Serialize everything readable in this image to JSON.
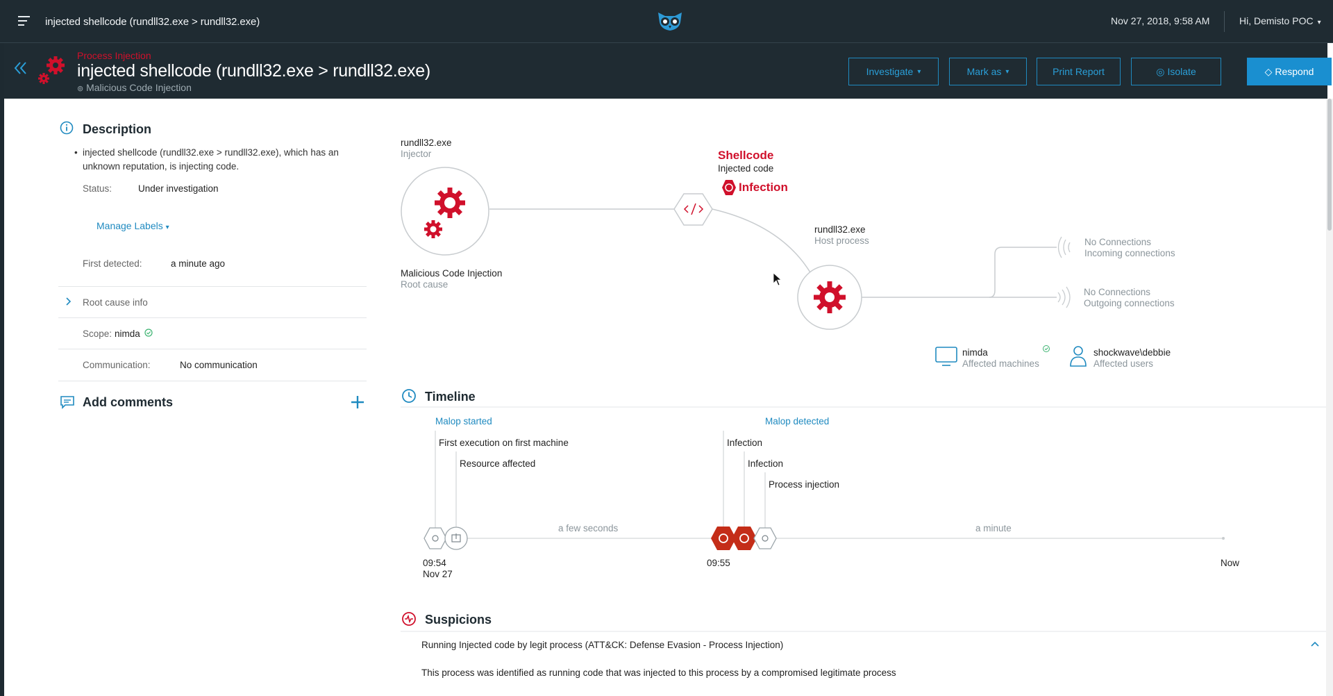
{
  "topbar": {
    "title": "injected shellcode (rundll32.exe > rundll32.exe)",
    "datetime": "Nov 27, 2018, 9:58 AM",
    "user_greeting": "Hi, Demisto POC"
  },
  "header": {
    "malop_type": "Process Injection",
    "title": "injected shellcode (rundll32.exe > rundll32.exe)",
    "subtitle": "Malicious Code Injection",
    "buttons": {
      "investigate": "Investigate",
      "mark_as": "Mark as",
      "print_report": "Print Report",
      "isolate": "Isolate",
      "respond": "Respond"
    }
  },
  "description": {
    "heading": "Description",
    "text": "injected shellcode (rundll32.exe > rundll32.exe), which has an unknown reputation, is injecting code.",
    "status_label": "Status:",
    "status_value": "Under investigation",
    "manage_labels": "Manage Labels",
    "first_detected_label": "First detected:",
    "first_detected_value": "a minute ago",
    "root_cause": "Root cause info",
    "scope_label": "Scope:",
    "scope_value": "nimda",
    "communication_label": "Communication:",
    "communication_value": "No communication"
  },
  "comments": {
    "heading": "Add comments"
  },
  "diagram": {
    "injector_name": "rundll32.exe",
    "injector_role": "Injector",
    "root_name": "Malicious Code Injection",
    "root_role": "Root cause",
    "shellcode_title": "Shellcode",
    "shellcode_sub": "Injected code",
    "infection": "Infection",
    "host_name": "rundll32.exe",
    "host_role": "Host process",
    "incoming_title": "No Connections",
    "incoming_sub": "Incoming connections",
    "outgoing_title": "No Connections",
    "outgoing_sub": "Outgoing connections",
    "machine_name": "nimda",
    "machine_sub": "Affected machines",
    "user_name": "shockwave\\debbie",
    "user_sub": "Affected users"
  },
  "timeline": {
    "heading": "Timeline",
    "malop_started": "Malop started",
    "malop_detected": "Malop detected",
    "events": {
      "first_execution": "First execution on first machine",
      "resource_affected": "Resource affected",
      "infection_1": "Infection",
      "infection_2": "Infection",
      "process_injection": "Process injection"
    },
    "gap_1": "a few seconds",
    "gap_2": "a minute",
    "time_start": "09:54",
    "date_start": "Nov 27",
    "time_detected": "09:55",
    "now": "Now"
  },
  "suspicions": {
    "heading": "Suspicions",
    "item_title": "Running Injected code by legit process (ATT&CK: Defense Evasion - Process Injection)",
    "item_description": "This process was identified as running code that was injected to this process by a compromised legitimate process"
  },
  "colors": {
    "dark_bg": "#1f2b32",
    "accent_blue": "#1f8ac0",
    "malicious_red": "#d0102b"
  }
}
